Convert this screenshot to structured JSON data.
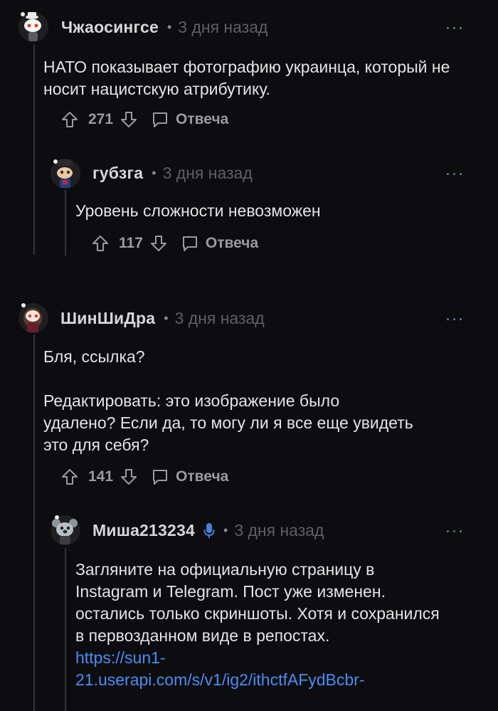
{
  "colors": {
    "background": "#0d0d0f",
    "thread_line": "#343438",
    "link": "#4a8df6",
    "mic_badge": "#4a7fd8"
  },
  "comments": [
    {
      "author": "Чжаосингсе",
      "dot": "•",
      "time": "3 дня назад",
      "paragraphs": [
        "НАТО показывает фотографию украинца, который не носит нацистскую атрибутику."
      ],
      "score": "271",
      "reply_label": "Отвеча"
    },
    {
      "author": "губзга",
      "dot": "•",
      "time": "3 дня назад",
      "paragraphs": [
        "Уровень сложности невозможен"
      ],
      "score": "117",
      "reply_label": "Отвеча"
    },
    {
      "author": "ШинШиДра",
      "dot": "•",
      "time": "3 дня назад",
      "paragraphs": [
        "Бля, ссылка?",
        "Редактировать: это изображение было удалено? Если да, то могу ли я все еще увидеть это для себя?"
      ],
      "score": "141",
      "reply_label": "Отвеча"
    },
    {
      "author": "Миша213234",
      "dot": "•",
      "time": "3 дня назад",
      "icon": "microphone-icon",
      "paragraphs": [
        "Загляните на официальную страницу в Instagram и Telegram. Пост уже изменен. остались только скриншоты. Хотя и сохранился в первозданном виде в репостах."
      ],
      "link": "https://sun1-21.userapi.com/s/v1/ig2/ithctfAFydBcbr-"
    }
  ],
  "link_lines": [
    "https://sun1-",
    "21.userapi.com/s/v1/ig2/ithctfAFydBcbr-"
  ]
}
